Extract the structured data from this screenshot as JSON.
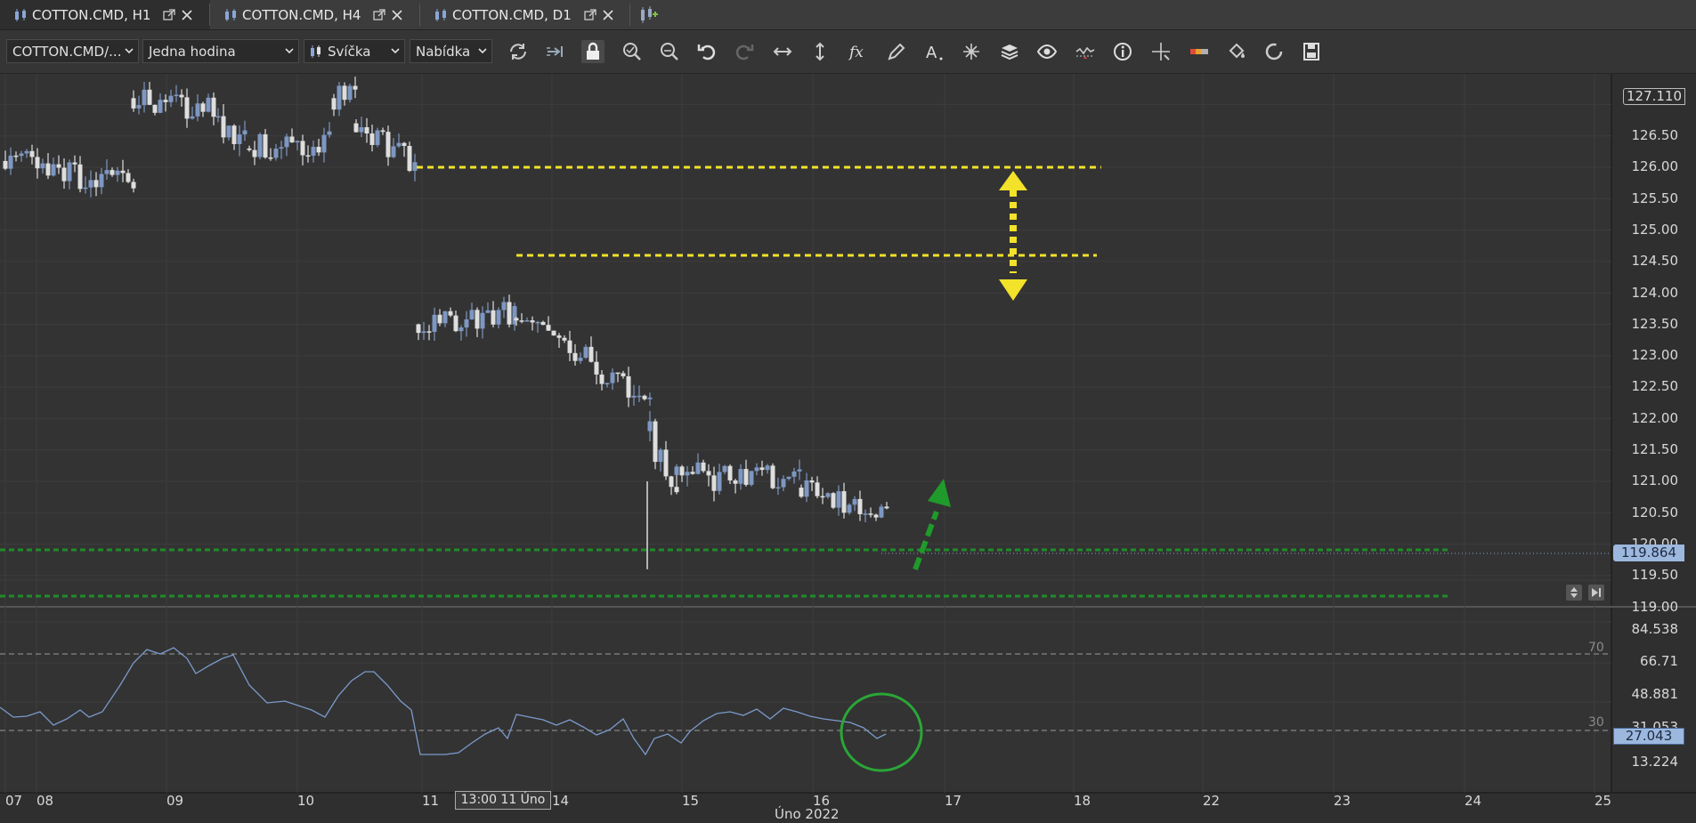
{
  "tabs": [
    {
      "label": "COTTON.CMD, H1",
      "active": true
    },
    {
      "label": "COTTON.CMD, H4",
      "active": false
    },
    {
      "label": "COTTON.CMD, D1",
      "active": false
    }
  ],
  "toolbar": {
    "instrument": "COTTON.CMD/...",
    "period": "Jedna hodina",
    "chart_type": "Svíčka",
    "price_side": "Nabídka",
    "tools": [
      "refresh-icon",
      "auto-shift-icon",
      "lock-icon",
      "zoom-in-icon",
      "zoom-out-icon",
      "undo-icon",
      "redo-icon",
      "horizontal-resize-icon",
      "vertical-resize-icon",
      "fx-indicator-icon",
      "pencil-draw-icon",
      "text-tool-icon",
      "objects-icon",
      "layers-icon",
      "eye-icon",
      "chart-overlay-icon",
      "info-icon",
      "crosshair-icon",
      "color-scheme-icon",
      "paint-bucket-icon",
      "loading-icon",
      "save-icon"
    ]
  },
  "price_axis": {
    "current_top": "127.110",
    "labels": [
      "126.50",
      "126.00",
      "125.50",
      "125.00",
      "124.50",
      "124.00",
      "123.50",
      "123.00",
      "122.50",
      "122.00",
      "121.50",
      "121.00",
      "120.50",
      "120.00",
      "119.50",
      "119.00"
    ],
    "current_price": "119.864"
  },
  "rsi_axis": {
    "labels": [
      "84.538",
      "66.71",
      "48.881",
      "31.053",
      "13.224"
    ],
    "level_70": "70",
    "level_30": "30",
    "current_value": "27.043"
  },
  "time_axis": {
    "labels": [
      "07",
      "08",
      "09",
      "10",
      "11",
      "14",
      "15",
      "16",
      "17",
      "18",
      "22",
      "23",
      "24",
      "25"
    ],
    "cursor_label": "13:00 11 Úno",
    "month_label": "Úno 2022"
  },
  "annotations": {
    "resistance_color": "#f2e22a",
    "support_color": "#1f8c2a",
    "arrow_color": "#1f9a2b"
  },
  "colors": {
    "bull_candle": "#7d97c2",
    "bear_candle": "#dedede",
    "rsi_line": "#7a9acb",
    "current_price_box": "#9db8de"
  }
}
